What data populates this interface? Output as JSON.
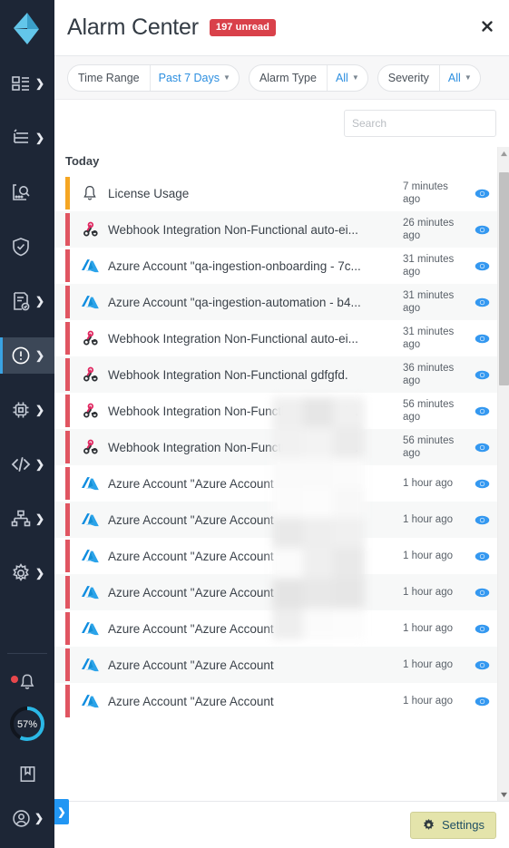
{
  "colors": {
    "sidebar_bg": "#1d2636",
    "logo": "#63c6ea",
    "accent_blue": "#2d8fe0",
    "badge_red": "#d9414a",
    "severity_critical": "#e05561",
    "severity_warning": "#f5a623",
    "eye_blue": "#3498f0",
    "settings_bg": "#e4e4ab",
    "progress_ring": "#2bb8e6"
  },
  "sidebar": {
    "logo_name": "logo-icon",
    "items": [
      {
        "icon": "dashboard-icon",
        "name": "sidebar-item-dashboards",
        "chevron": true,
        "active": false
      },
      {
        "icon": "list-icon",
        "name": "sidebar-item-resources",
        "chevron": true,
        "active": false
      },
      {
        "icon": "discovery-icon",
        "name": "sidebar-item-discovery",
        "chevron": false,
        "active": false
      },
      {
        "icon": "shield-icon",
        "name": "sidebar-item-security",
        "chevron": false,
        "active": false
      },
      {
        "icon": "report-icon",
        "name": "sidebar-item-reports",
        "chevron": true,
        "active": false
      },
      {
        "icon": "alert-icon",
        "name": "sidebar-item-alarms",
        "chevron": true,
        "active": true
      },
      {
        "icon": "chip-icon",
        "name": "sidebar-item-devices",
        "chevron": true,
        "active": false
      },
      {
        "icon": "code-icon",
        "name": "sidebar-item-code",
        "chevron": true,
        "active": false
      },
      {
        "icon": "topology-icon",
        "name": "sidebar-item-topology",
        "chevron": true,
        "active": false
      },
      {
        "icon": "gear-icon",
        "name": "sidebar-item-settings",
        "chevron": true,
        "active": false
      }
    ],
    "bottom": {
      "notification_icon": "bell-icon",
      "has_notification_dot": true,
      "progress_label": "57%",
      "progress_value": 57,
      "help_icon": "book-icon",
      "account_icon": "user-circle-icon",
      "expander_icon": "chevron-right-icon"
    }
  },
  "header": {
    "title": "Alarm Center",
    "unread_badge": "197 unread",
    "close_icon": "close-icon"
  },
  "filters": [
    {
      "label": "Time Range",
      "value": "Past 7 Days",
      "name": "filter-time-range"
    },
    {
      "label": "Alarm Type",
      "value": "All",
      "name": "filter-alarm-type"
    },
    {
      "label": "Severity",
      "value": "All",
      "name": "filter-severity"
    }
  ],
  "search": {
    "placeholder": "Search",
    "value": "",
    "icon": "search-icon"
  },
  "list": {
    "group_label": "Today",
    "rows": [
      {
        "severity": "warning",
        "icon": "bell-icon",
        "title": "License Usage",
        "time": "7 minutes ago"
      },
      {
        "severity": "critical",
        "icon": "webhook-icon",
        "title": "Webhook Integration Non-Functional auto-ei...",
        "time": "26 minutes ago"
      },
      {
        "severity": "critical",
        "icon": "azure-icon",
        "title": "Azure Account \"qa-ingestion-onboarding - 7c...",
        "time": "31 minutes ago"
      },
      {
        "severity": "critical",
        "icon": "azure-icon",
        "title": "Azure Account \"qa-ingestion-automation - b4...",
        "time": "31 minutes ago"
      },
      {
        "severity": "critical",
        "icon": "webhook-icon",
        "title": "Webhook Integration Non-Functional auto-ei...",
        "time": "31 minutes ago"
      },
      {
        "severity": "critical",
        "icon": "webhook-icon",
        "title": "Webhook Integration Non-Functional gdfgfd.",
        "time": "36 minutes ago"
      },
      {
        "severity": "critical",
        "icon": "webhook-icon",
        "title": "Webhook Integration Non-Functional auto-ei...",
        "time": "56 minutes ago"
      },
      {
        "severity": "critical",
        "icon": "webhook-icon",
        "title": "Webhook Integration Non-Functional auto-ei...",
        "time": "56 minutes ago"
      },
      {
        "severity": "critical",
        "icon": "azure-icon",
        "title": "Azure Account \"Azure Account",
        "time": "1 hour ago",
        "truncate_mark": ".."
      },
      {
        "severity": "critical",
        "icon": "azure-icon",
        "title": "Azure Account \"Azure Account",
        "time": "1 hour ago",
        "truncate_mark": ".."
      },
      {
        "severity": "critical",
        "icon": "azure-icon",
        "title": "Azure Account \"Azure Account",
        "time": "1 hour ago",
        "truncate_mark": ".."
      },
      {
        "severity": "critical",
        "icon": "azure-icon",
        "title": "Azure Account \"Azure Account",
        "time": "1 hour ago",
        "truncate_mark": ".."
      },
      {
        "severity": "critical",
        "icon": "azure-icon",
        "title": "Azure Account \"Azure Account",
        "time": "1 hour ago",
        "truncate_mark": ".."
      },
      {
        "severity": "critical",
        "icon": "azure-icon",
        "title": "Azure Account \"Azure Account",
        "time": "1 hour ago",
        "truncate_mark": ".."
      },
      {
        "severity": "critical",
        "icon": "azure-icon",
        "title": "Azure Account \"Azure Account",
        "time": "1 hour ago",
        "truncate_mark": ".."
      }
    ],
    "row_action_icon": "eye-icon",
    "scroll": {
      "up_arrow": "caret-up-icon",
      "down_arrow": "caret-down-icon",
      "thumb_top_pct": 2,
      "thumb_height_pct": 34
    }
  },
  "footer": {
    "settings_label": "Settings",
    "settings_icon": "gear-icon"
  }
}
